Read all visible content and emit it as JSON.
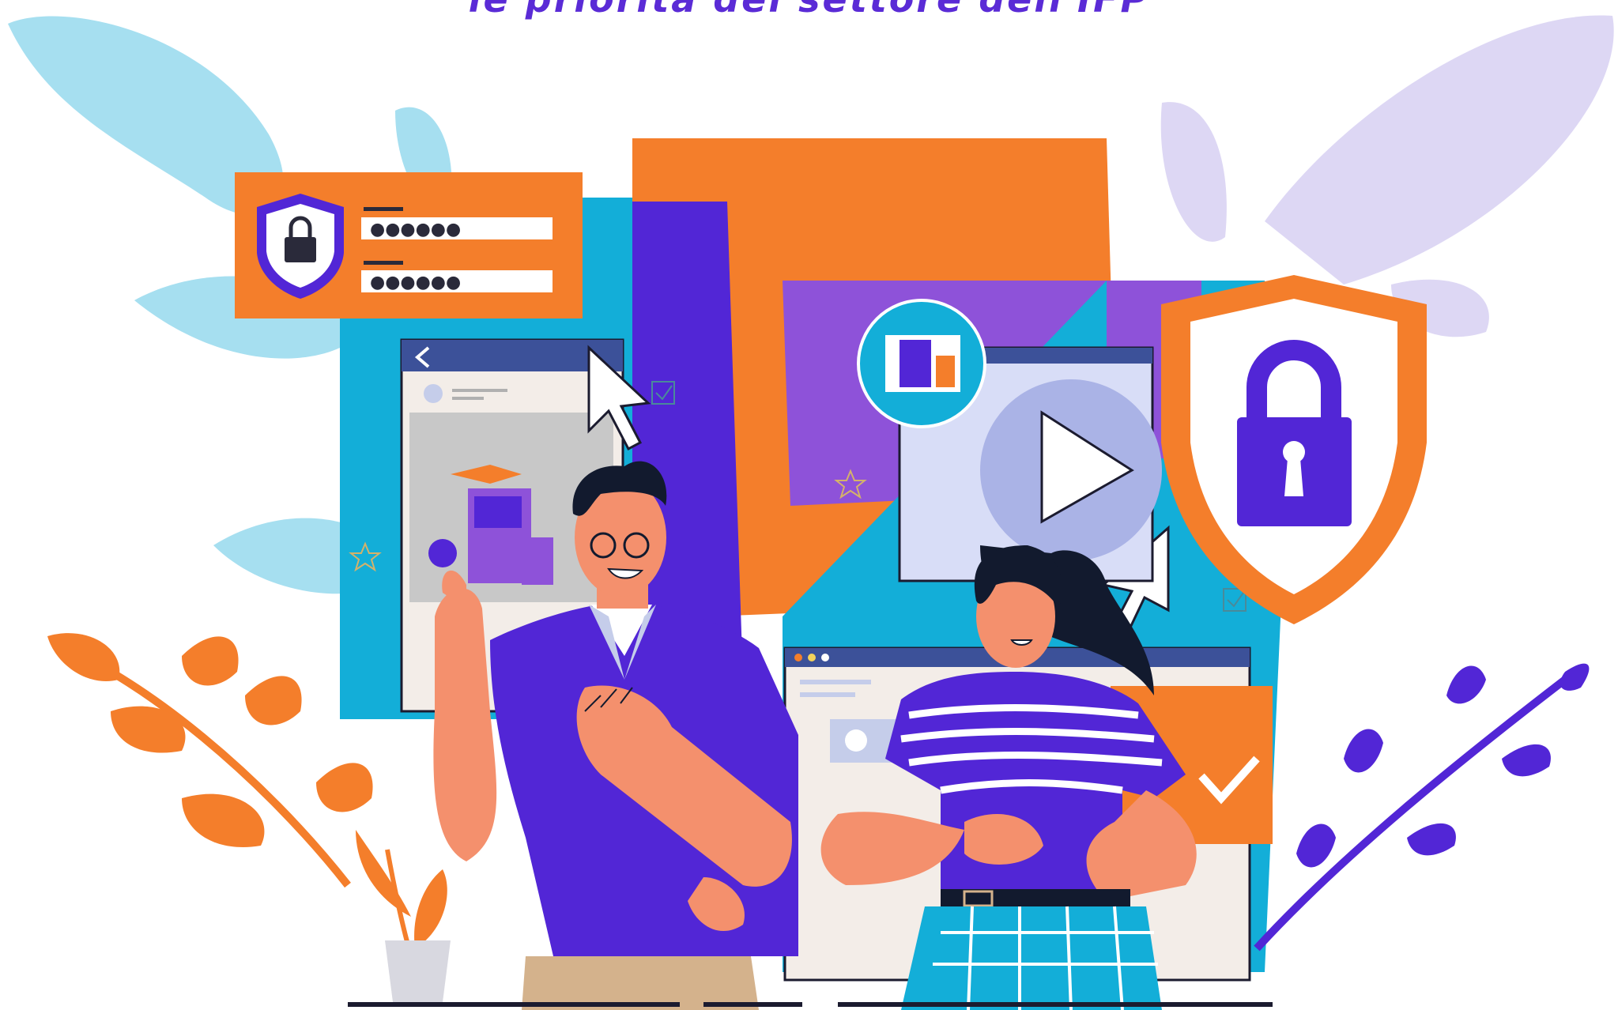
{
  "headline": "le priorità del settore dell'IFP",
  "login_card": {
    "password_dots_1": "●●●●●●",
    "password_dots_2": "●●●●●●"
  },
  "icons": [
    "shield-lock-icon",
    "padlock-icon",
    "cursor-arrow-icon",
    "play-icon",
    "checkbox-icon",
    "star-icon",
    "back-arrow-icon",
    "id-badge-icon"
  ],
  "colors": {
    "purple": "#5226d6",
    "orange": "#f47e2b",
    "blue": "#13aed8",
    "light_blue": "#a6dff0",
    "lavender": "#ddd7f4",
    "skin": "#f4906d",
    "hair": "#121a2e"
  }
}
